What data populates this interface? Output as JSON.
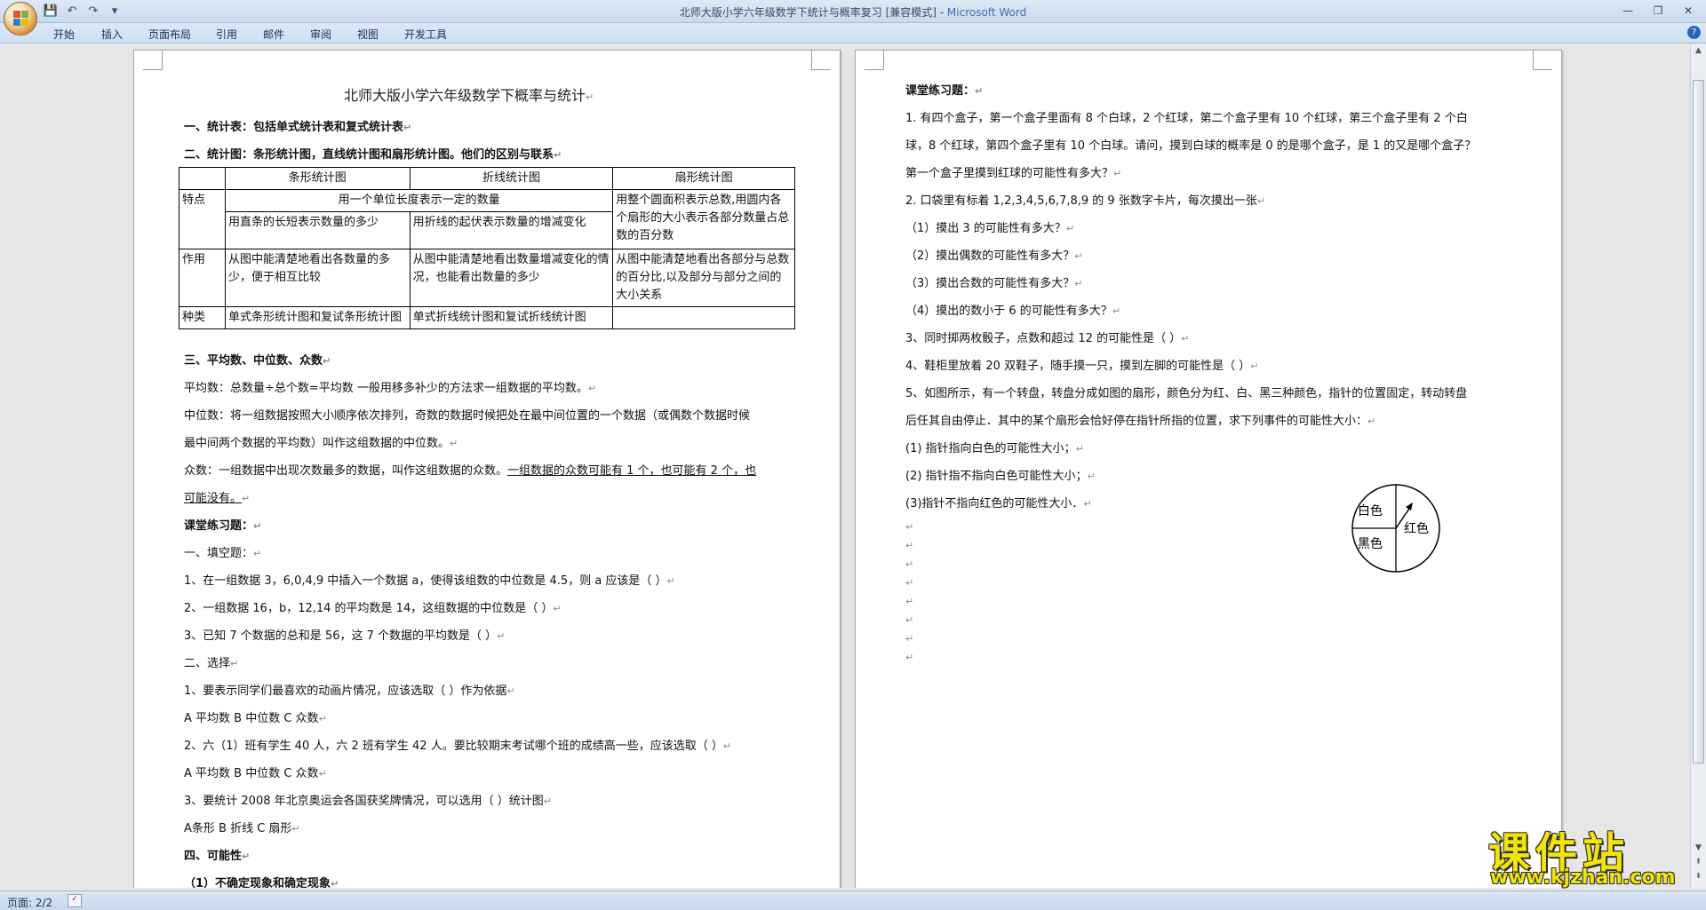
{
  "window": {
    "title": "北师大版小学六年级数学下统计与概率复习 [兼容模式] - ",
    "app_name": "Microsoft Word",
    "minimize": "—",
    "restore": "❐",
    "close": "✕"
  },
  "qat": {
    "save": "💾",
    "undo": "↶",
    "redo": "↷",
    "more": "▾"
  },
  "ribbon_tabs": [
    "开始",
    "插入",
    "页面布局",
    "引用",
    "邮件",
    "审阅",
    "视图",
    "开发工具"
  ],
  "help": "?",
  "left_page": {
    "title": "北师大版小学六年级数学下概率与统计",
    "sec1": "一、统计表：包括单式统计表和复式统计表",
    "sec2": "二、统计图：条形统计图，直线统计图和扇形统计图。他们的区别与联系",
    "table": {
      "headers": [
        "",
        "条形统计图",
        "折线统计图",
        "扇形统计图"
      ],
      "row_tedian_label": "特点",
      "row_tedian_shared": "用一个单位长度表示一定的数量",
      "row_tedian_bar": "用直条的长短表示数量的多少",
      "row_tedian_line": "用折线的起伏表示数量的增减变化",
      "row_tedian_pie": "用整个圆面积表示总数,用圆内各个扇形的大小表示各部分数量占总数的百分数",
      "row_zuoyong_label": "作用",
      "row_zuoyong_bar": "从图中能清楚地看出各数量的多少，便于相互比较",
      "row_zuoyong_line": "从图中能清楚地看出数量增减变化的情况，也能看出数量的多少",
      "row_zuoyong_pie": "从图中能清楚地看出各部分与总数的百分比,以及部分与部分之间的大小关系",
      "row_zhonglei_label": "种类",
      "row_zhonglei_bar": "单式条形统计图和复试条形统计图",
      "row_zhonglei_line": "单式折线统计图和复试折线统计图",
      "row_zhonglei_pie": ""
    },
    "sec3": "三、平均数、中位数、众数",
    "mean": "平均数：总数量÷总个数=平均数      一般用移多补少的方法求一组数据的平均数。",
    "median_1": "中位数：将一组数据按照大小顺序依次排列，奇数的数据时候把处在最中间位置的一个数据（或偶数个数据时候",
    "median_2": "最中间两个数据的平均数）叫作这组数据的中位数。",
    "mode_1a": "众数：一组数据中出现次数最多的数据，叫作这组数据的众数。",
    "mode_1b": "一组数据的众数可能有 1 个，也可能有 2 个，也",
    "mode_2": "可能没有。",
    "practice": "课堂练习题：",
    "fill": "一、填空题：",
    "q1": "1、在一组数据 3，6,0,4,9 中插入一个数据 a，使得该组数的中位数是 4.5，则 a 应该是（      ）",
    "q2": "2、一组数据 16，b，12,14 的平均数是 14，这组数据的中位数是（      ）",
    "q3": "3、已知 7 个数据的总和是 56，这 7 个数据的平均数是（  ）",
    "choose": "二、选择",
    "c1": "1、要表示同学们最喜欢的动画片情况，应该选取（    ）作为依据",
    "c1_opts": "A 平均数           B 中位数           C 众数",
    "c2": "2、六（1）班有学生 40 人，六 2 班有学生 42 人。要比较期末考试哪个班的成绩高一些，应该选取（      ）",
    "c2_opts": "A 平均数           B 中位数           C 众数",
    "c3": "3、要统计 2008 年北京奥运会各国获奖牌情况，可以选用（   ）统计图",
    "c3_opts": "A条形      B     折线      C  扇形",
    "sec4": "四、可能性",
    "sub1": "（1）不确定现象和确定现象"
  },
  "right_page": {
    "practice": "课堂练习题：",
    "p1_a": "1.    有四个盒子，第一个盒子里面有 8 个白球，2 个红球，第二个盒子里有 10 个红球，第三个盒子里有 2 个白",
    "p1_b": "球，8 个红球，第四个盒子里有 10 个白球。请问，摸到白球的概率是 0 的是哪个盒子，是 1 的又是哪个盒子？",
    "p1_c": "第一个盒子里摸到红球的可能性有多大？",
    "p2": "2.    口袋里有标着 1,2,3,4,5,6,7,8,9 的 9 张数字卡片，每次摸出一张",
    "p2_1": "（1）摸出 3 的可能性有多大？",
    "p2_2": "（2）摸出偶数的可能性有多大？",
    "p2_3": "（3）摸出合数的可能性有多大？",
    "p2_4": "（4）摸出的数小于 6 的可能性有多大？",
    "p3": "3、同时掷两枚骰子，点数和超过 12 的可能性是（        ）",
    "p4": "4、鞋柜里放着 20 双鞋子，随手摸一只，摸到左脚的可能性是（     ）",
    "p5_a": "5、如图所示，有一个转盘，转盘分成如图的扇形，颜色分为红、白、黑三种颜色，指针的位置固定，转动转盘",
    "p5_b": "后任其自由停止．其中的某个扇形会恰好停在指针所指的位置，求下列事件的可能性大小：",
    "p5_1": "(1) 指针指向白色的可能性大小；",
    "p5_2": "(2) 指针指不指向白色可能性大小；",
    "p5_3": "(3)指针不指向红色的可能性大小．",
    "spinner": {
      "white": "白色",
      "red": "红色",
      "black": "黑色"
    }
  },
  "para_mark": "↵",
  "status": {
    "page": "页面: 2/2"
  },
  "watermark": {
    "logo": "课件站",
    "url": "www.kjzhan.com"
  }
}
